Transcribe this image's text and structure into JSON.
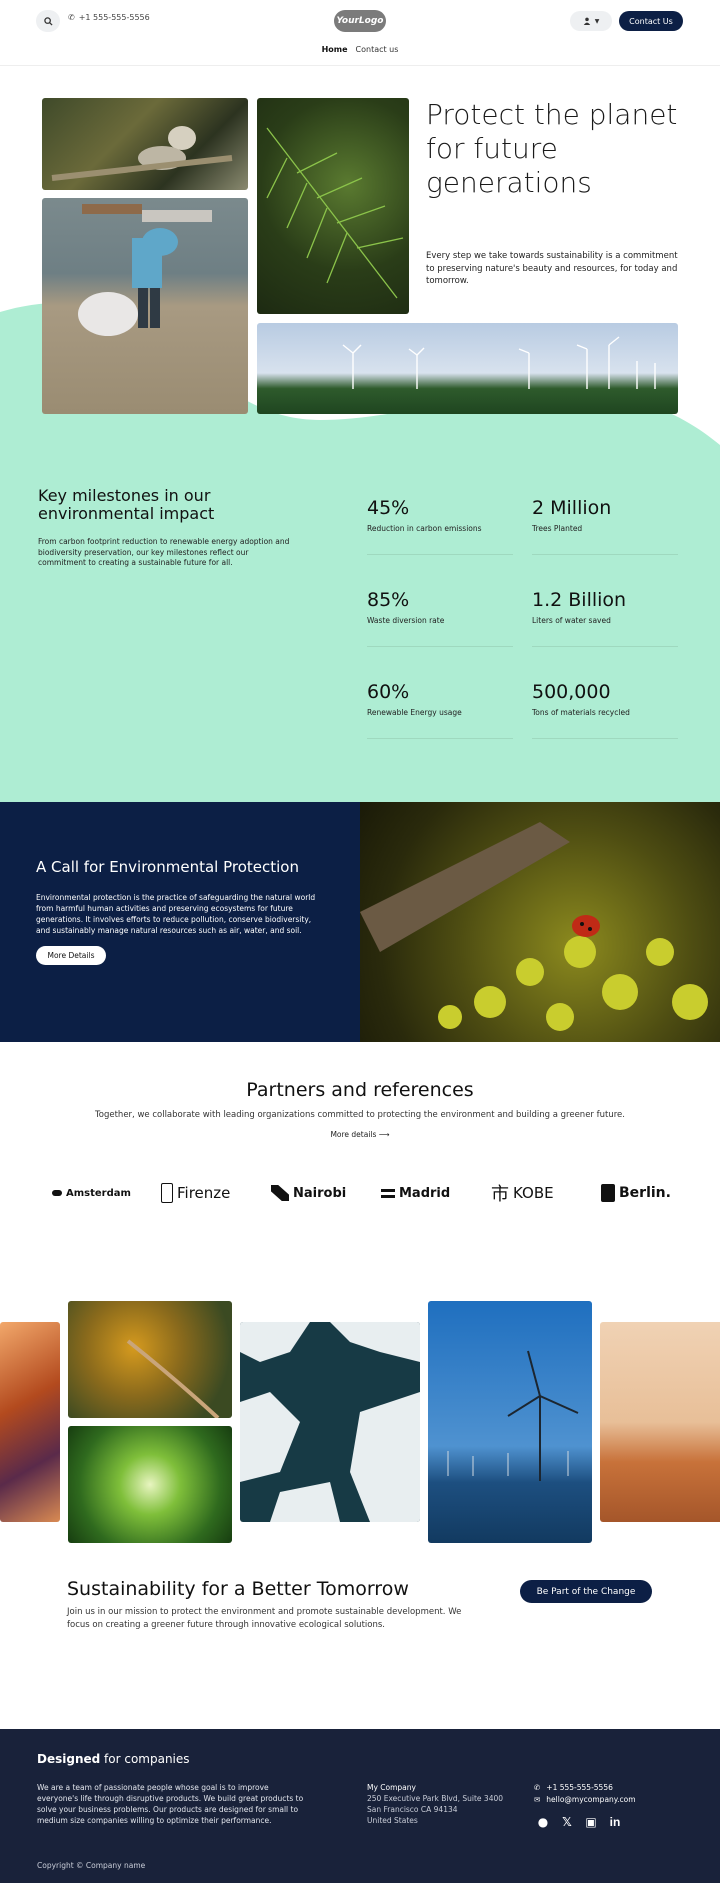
{
  "header": {
    "phone": "+1 555-555-5556",
    "logo_text": "YourLogo",
    "contact_button": "Contact Us",
    "nav": [
      {
        "label": "Home"
      },
      {
        "label": "Contact us"
      }
    ]
  },
  "hero": {
    "title": "Protect the planet for future generations",
    "text": "Every step we take towards sustainability is a commitment to preserving nature's beauty and resources, for today and tomorrow."
  },
  "milestones": {
    "title": "Key milestones in our environmental impact",
    "text": "From carbon footprint reduction to renewable energy adoption and biodiversity preservation, our key milestones reflect our commitment to creating a sustainable future for all.",
    "stats": [
      {
        "value": "45%",
        "label": "Reduction in carbon emissions"
      },
      {
        "value": "2 Million",
        "label": "Trees Planted"
      },
      {
        "value": "85%",
        "label": "Waste diversion rate"
      },
      {
        "value": "1.2 Billion",
        "label": "Liters of water saved"
      },
      {
        "value": "60%",
        "label": "Renewable Energy usage"
      },
      {
        "value": "500,000",
        "label": "Tons of materials recycled"
      }
    ]
  },
  "call": {
    "title": "A Call for Environmental Protection",
    "text": "Environmental protection is the practice of safeguarding the natural world from harmful human activities and preserving ecosystems for future generations. It involves efforts to reduce pollution, conserve biodiversity, and sustainably manage natural resources such as air, water, and soil.",
    "button": "More Details"
  },
  "partners": {
    "title": "Partners and references",
    "subtitle": "Together, we collaborate with leading organizations committed to protecting the environment and building a greener future.",
    "link": "More details",
    "brands": [
      "Amsterdam",
      "Firenze",
      "Nairobi",
      "Madrid",
      "KOBE",
      "Berlin."
    ]
  },
  "sustain": {
    "title": "Sustainability for a Better Tomorrow",
    "text": "Join us in our mission to protect the environment and promote sustainable development. We focus on creating a greener future through innovative ecological solutions.",
    "button": "Be Part of the Change"
  },
  "footer": {
    "heading_bold": "Designed",
    "heading_rest": " for companies",
    "text": "We are a team of passionate people whose goal is to improve everyone's life through disruptive products. We build great products to solve your business problems. Our products are designed for small to medium size companies willing to optimize their performance.",
    "company": "My Company",
    "address1": "250 Executive Park Blvd, Suite 3400",
    "address2": "San Francisco CA 94134",
    "country": "United States",
    "phone": "+1 555-555-5556",
    "email": "hello@mycompany.com",
    "copyright": "Copyright © Company name"
  }
}
